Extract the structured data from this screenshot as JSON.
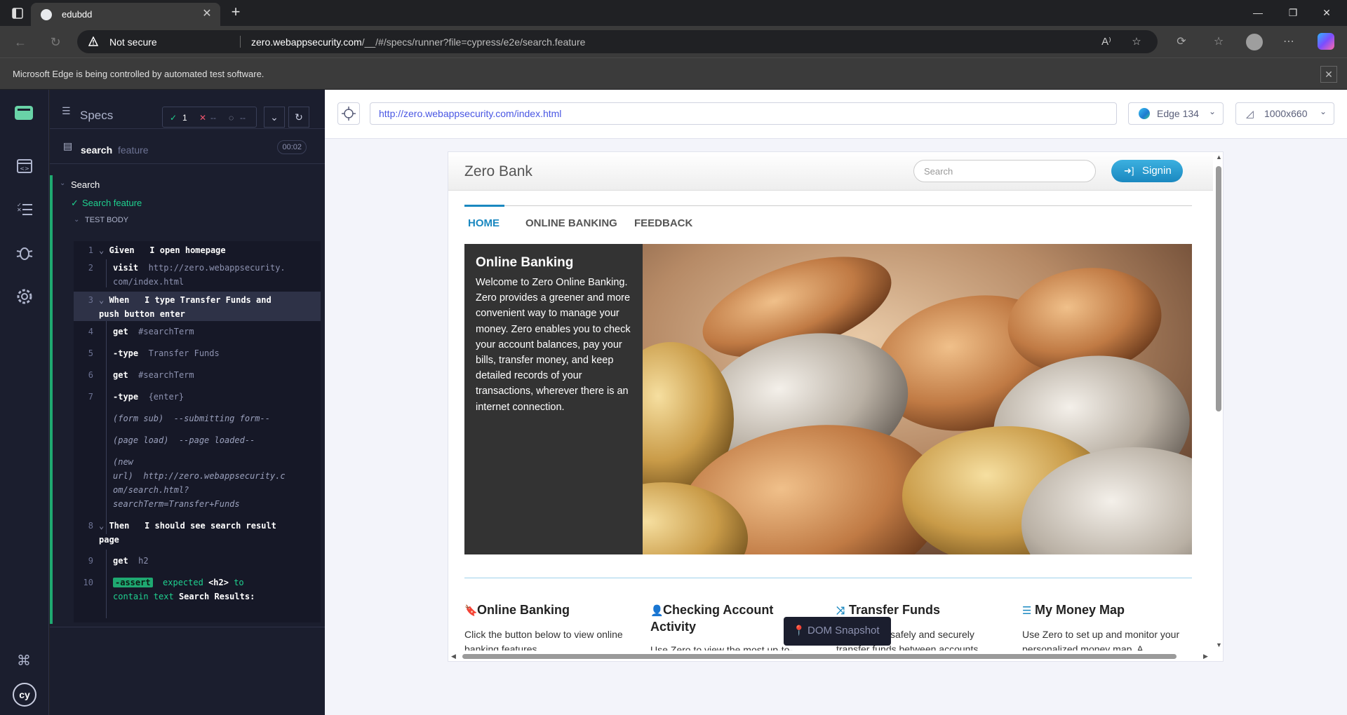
{
  "browser": {
    "tab_title": "edubdd",
    "security_label": "Not secure",
    "url_domain": "zero.webappsecurity.com",
    "url_path": "/__/#/specs/runner?file=cypress/e2e/search.feature",
    "automation_notice": "Microsoft Edge is being controlled by automated test software."
  },
  "reporter": {
    "header_label": "Specs",
    "stats": {
      "passed": "1",
      "failed": "--",
      "pending": "--"
    },
    "spec_name": "search",
    "spec_ext": "feature",
    "duration": "00:02",
    "suite_title": "Search",
    "test_title": "Search feature",
    "body_label": "TEST BODY",
    "commands": [
      {
        "num": "1",
        "keyword": "Given",
        "text": "I open homepage"
      },
      {
        "num": "2",
        "name": "visit",
        "msg": "http://zero.webappsecurity.",
        "msg2": "com/index.html"
      },
      {
        "num": "3",
        "keyword": "When",
        "text": "I type Transfer Funds and",
        "text2": "push button enter"
      },
      {
        "num": "4",
        "name": "get",
        "msg": "#searchTerm"
      },
      {
        "num": "5",
        "name": "-type",
        "msg": "Transfer Funds"
      },
      {
        "num": "6",
        "name": "get",
        "msg": "#searchTerm"
      },
      {
        "num": "7",
        "name": "-type",
        "msg": "{enter}"
      },
      {
        "event": "(form sub)",
        "msg": "--submitting form--"
      },
      {
        "event": "(page load)",
        "msg": "--page loaded--"
      },
      {
        "event": "(new",
        "event2": "url)",
        "msg": "http://zero.webappsecurity.c",
        "msg2": "om/search.html?",
        "msg3": "searchTerm=Transfer+Funds"
      },
      {
        "num": "8",
        "keyword": "Then",
        "text": "I should see search result",
        "text2": "page"
      },
      {
        "num": "9",
        "name": "get",
        "msg": "h2"
      },
      {
        "num": "10",
        "name": "-assert",
        "msg": "expected",
        "tag": "<h2>",
        "to": "to",
        "line2_a": "contain text",
        "line2_b": "Search Results:"
      }
    ]
  },
  "aut": {
    "url": "http://zero.webappsecurity.com/index.html",
    "browser_label": "Edge 134",
    "viewport_label": "1000x660"
  },
  "site": {
    "brand": "Zero Bank",
    "search_placeholder": "Search",
    "signin_label": "Signin",
    "nav": [
      "HOME",
      "ONLINE BANKING",
      "FEEDBACK"
    ],
    "hero_title": "Online Banking",
    "hero_text": "Welcome to Zero Online Banking. Zero provides a greener and more convenient way to manage your money. Zero enables you to check your account balances, pay your bills, transfer money, and keep detailed records of your transactions, wherever there is an internet connection.",
    "features": [
      {
        "title": "Online Banking",
        "text": "Click the button below to view online banking features."
      },
      {
        "title": "Checking Account Activity",
        "text": "Use Zero to view the most up-to-"
      },
      {
        "title": "Transfer Funds",
        "text": "Use Zero to safely and securely transfer funds between accounts."
      },
      {
        "title": "My Money Map",
        "text": "Use Zero to set up and monitor your personalized money map. A"
      }
    ]
  },
  "snapshot_label": "DOM Snapshot",
  "colors": {
    "cypress_green": "#1fa971",
    "zero_blue": "#1a88c0",
    "reporter_bg": "#1b1e2e"
  }
}
